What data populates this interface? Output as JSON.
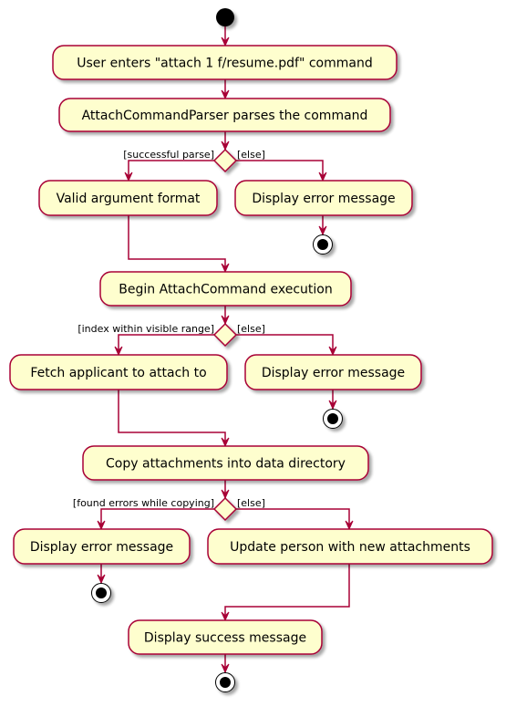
{
  "diagram": {
    "type": "activity",
    "colors": {
      "border": "#A80036",
      "fill": "#FEFECE",
      "node": "#000000",
      "shadow": "#BBBBBB"
    },
    "start": {
      "label": "start"
    },
    "activities": [
      {
        "id": "a1",
        "label": "User enters \"attach 1 f/resume.pdf\" command"
      },
      {
        "id": "a2",
        "label": "AttachCommandParser parses the command"
      },
      {
        "id": "a3",
        "label": "Valid argument format"
      },
      {
        "id": "a4",
        "label": "Display error message"
      },
      {
        "id": "a5",
        "label": "Begin AttachCommand execution"
      },
      {
        "id": "a6",
        "label": "Fetch applicant to attach to"
      },
      {
        "id": "a7",
        "label": "Display error message"
      },
      {
        "id": "a8",
        "label": "Copy attachments into data directory"
      },
      {
        "id": "a9",
        "label": "Display error message"
      },
      {
        "id": "a10",
        "label": "Update person with new attachments"
      },
      {
        "id": "a11",
        "label": "Display success message"
      }
    ],
    "decisions": [
      {
        "id": "d1",
        "yes_guard": "[successful parse]",
        "else_guard": "[else]"
      },
      {
        "id": "d2",
        "yes_guard": "[index within visible range]",
        "else_guard": "[else]"
      },
      {
        "id": "d3",
        "yes_guard": "[found errors while copying]",
        "else_guard": "[else]"
      }
    ],
    "stops": [
      {
        "id": "s1",
        "after": "a4"
      },
      {
        "id": "s2",
        "after": "a7"
      },
      {
        "id": "s3",
        "after": "a9"
      },
      {
        "id": "s4",
        "after": "a11"
      }
    ]
  }
}
